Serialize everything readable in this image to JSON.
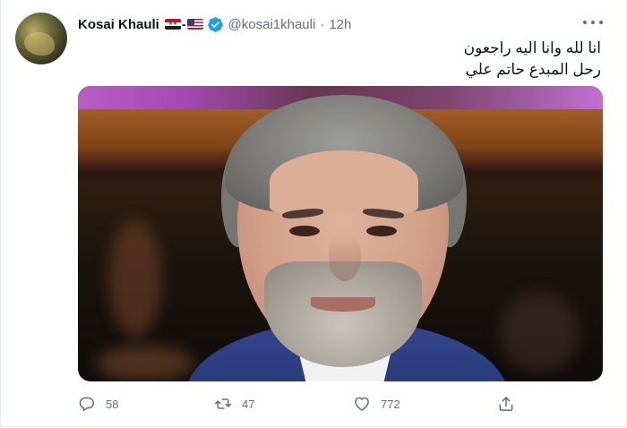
{
  "tweet": {
    "display_name": "Kosai Khauli",
    "flag_separator": "-",
    "handle": "@kosai1khauli",
    "separator": "·",
    "time": "12h",
    "text_lines": [
      "انا لله وانا اليه راجعون",
      "رحل المبدع حاتم علي"
    ],
    "icons": {
      "flag_1": "syria-flag-icon",
      "flag_2": "us-flag-icon",
      "verified": "verified-badge-icon",
      "more": "more-options-icon"
    }
  },
  "actions": {
    "reply": {
      "icon": "reply-icon",
      "count": "58"
    },
    "retweet": {
      "icon": "retweet-icon",
      "count": "47"
    },
    "like": {
      "icon": "heart-icon",
      "count": "772"
    },
    "share": {
      "icon": "share-icon"
    }
  },
  "colors": {
    "text": "#0f1419",
    "secondary": "#5b7083",
    "verified": "#1da1f2",
    "border": "#e6ecf0"
  }
}
